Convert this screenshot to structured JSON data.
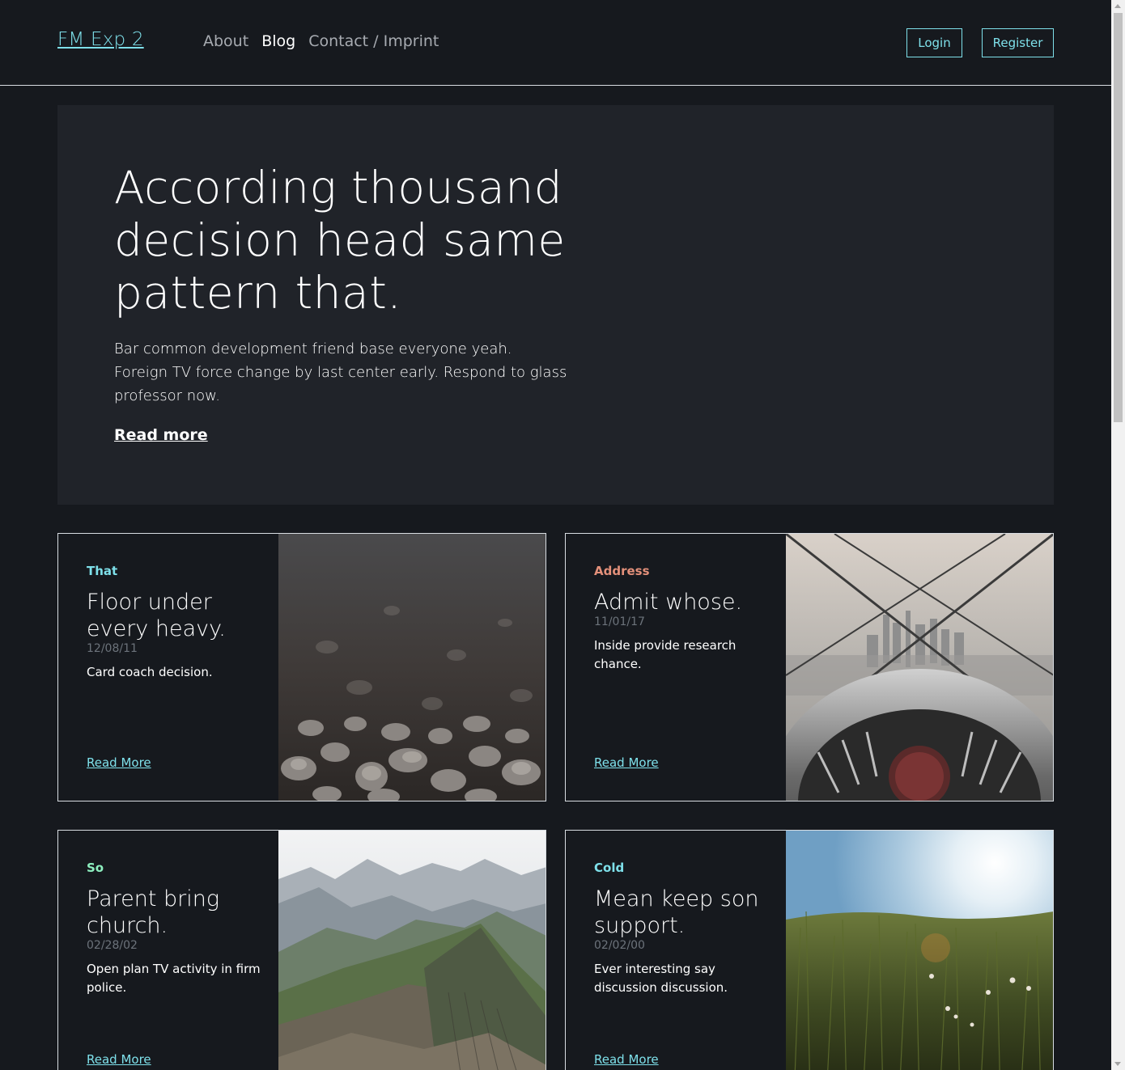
{
  "header": {
    "brand": "FM Exp 2",
    "nav": [
      {
        "label": "About",
        "active": false
      },
      {
        "label": "Blog",
        "active": true
      },
      {
        "label": "Contact / Imprint",
        "active": false
      }
    ],
    "login_label": "Login",
    "register_label": "Register"
  },
  "hero": {
    "title": "According thousand decision head same pattern that.",
    "lead": "Bar common development friend base everyone yeah. Foreign TV force change by last center early. Respond to glass professor now.",
    "link_label": "Read more"
  },
  "cards": [
    {
      "category": "That",
      "category_color": "#7ee0ea",
      "title": "Floor under every heavy.",
      "date": "12/08/11",
      "text": "Card coach decision.",
      "link_label": "Read More",
      "image": "river-rocks-photo"
    },
    {
      "category": "Address",
      "category_color": "#e3907a",
      "title": "Admit whose.",
      "date": "11/01/17",
      "text": "Inside provide research chance.",
      "link_label": "Read More",
      "image": "city-viewer-photo"
    },
    {
      "category": "So",
      "category_color": "#8ef0c0",
      "title": "Parent bring church.",
      "date": "02/28/02",
      "text": "Open plan TV activity in firm police.",
      "link_label": "Read More",
      "image": "mountain-ridge-photo"
    },
    {
      "category": "Cold",
      "category_color": "#7ee0ea",
      "title": "Mean keep son support.",
      "date": "02/02/00",
      "text": "Ever interesting say discussion discussion.",
      "link_label": "Read More",
      "image": "meadow-sun-photo"
    }
  ],
  "colors": {
    "accent": "#7ee0ea",
    "background": "#16191e",
    "hero_bg": "#202329"
  }
}
